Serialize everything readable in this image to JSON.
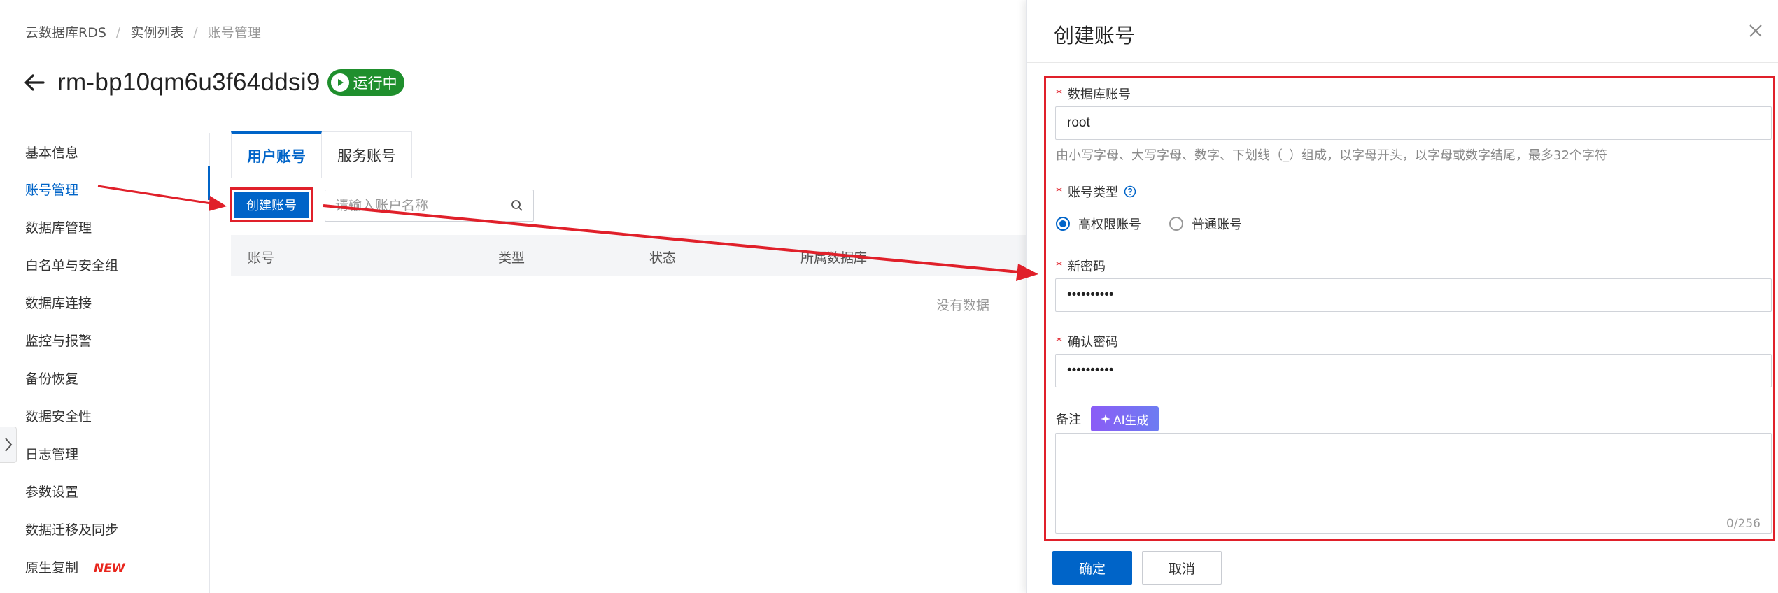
{
  "breadcrumb": [
    "云数据库RDS",
    "实例列表",
    "账号管理"
  ],
  "instance": {
    "name": "rm-bp10qm6u3f64ddsi9",
    "status": "运行中"
  },
  "sidenav": {
    "items": [
      "基本信息",
      "账号管理",
      "数据库管理",
      "白名单与安全组",
      "数据库连接",
      "监控与报警",
      "备份恢复",
      "数据安全性",
      "日志管理",
      "参数设置",
      "数据迁移及同步",
      "原生复制"
    ],
    "active_index": 1,
    "new_tag": "NEW"
  },
  "tabs": [
    "用户账号",
    "服务账号"
  ],
  "toolbar": {
    "create_label": "创建账号",
    "search_placeholder": "请输入账户名称"
  },
  "table": {
    "headers": [
      "账号",
      "类型",
      "状态",
      "所属数据库"
    ],
    "empty_text": "没有数据"
  },
  "drawer": {
    "title": "创建账号",
    "account": {
      "label": "数据库账号",
      "value": "root",
      "hint": "由小写字母、大写字母、数字、下划线（_）组成，以字母开头，以字母或数字结尾，最多32个字符"
    },
    "type": {
      "label": "账号类型",
      "options": [
        "高权限账号",
        "普通账号"
      ],
      "selected": 0
    },
    "new_password": {
      "label": "新密码",
      "value": "••••••••••"
    },
    "confirm_password": {
      "label": "确认密码",
      "value": "••••••••••"
    },
    "remark": {
      "label": "备注",
      "ai_label": "AI生成",
      "counter": "0/256"
    },
    "confirm_label": "确定",
    "cancel_label": "取消"
  },
  "colors": {
    "primary": "#0064c8",
    "status_green": "#1f8f2d",
    "annotation_red": "#e0202a",
    "new_tag": "#e8261d"
  }
}
